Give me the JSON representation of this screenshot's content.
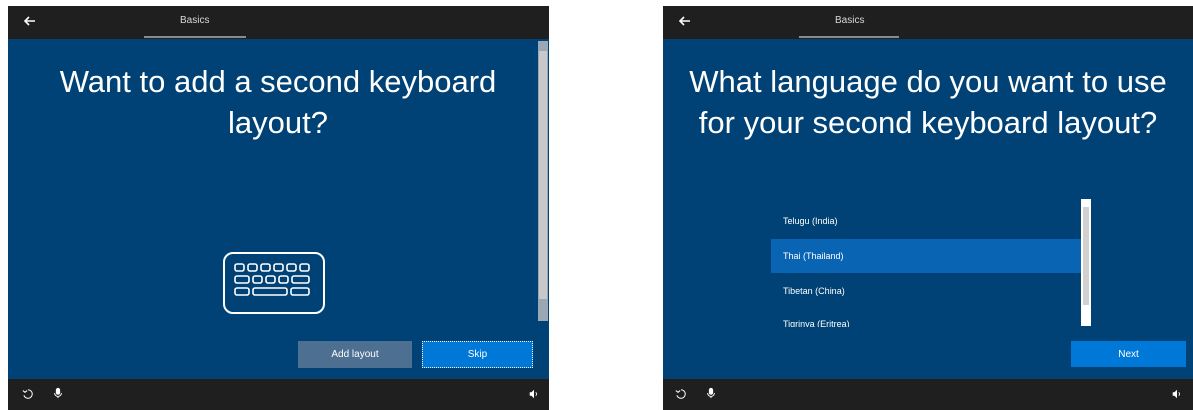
{
  "left": {
    "header": {
      "tab_label": "Basics"
    },
    "title": "Want to add a second keyboard layout?",
    "buttons": {
      "add_layout": "Add layout",
      "skip": "Skip"
    }
  },
  "right": {
    "header": {
      "tab_label": "Basics"
    },
    "title": "What language do you want to use for your second keyboard layout?",
    "languages": [
      {
        "label": "Telugu (India)",
        "selected": false
      },
      {
        "label": "Thai (Thailand)",
        "selected": true
      },
      {
        "label": "Tibetan (China)",
        "selected": false
      },
      {
        "label": "Tigrinya (Eritrea)",
        "selected": false
      }
    ],
    "buttons": {
      "next": "Next"
    }
  },
  "icons": [
    "back-arrow-icon",
    "keyboard-icon",
    "accessibility-icon",
    "microphone-icon",
    "volume-icon",
    "curved-arrow-icon"
  ],
  "colors": {
    "background": "#004275",
    "titlebar": "#1f1f1f",
    "button_primary": "#0078d7",
    "button_secondary": "#4d6f91",
    "selected_item": "#0a64b4"
  }
}
